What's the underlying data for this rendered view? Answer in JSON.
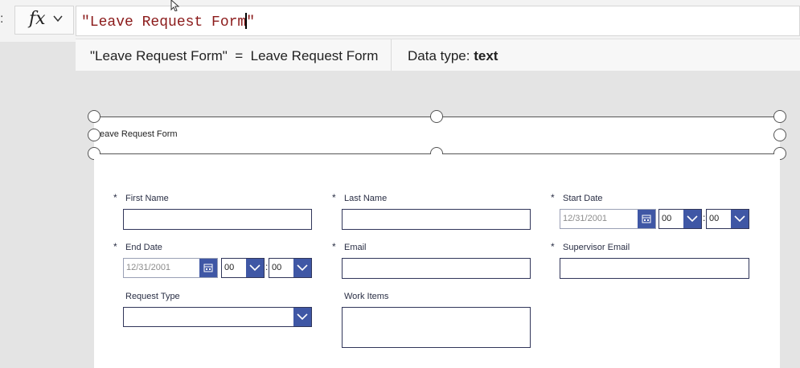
{
  "formula_bar": {
    "ellipsis": ":",
    "fx_label": "fx",
    "formula_before_caret": "\"Leave Request Form",
    "formula_after_caret": "\""
  },
  "result_bar": {
    "expression": "\"Leave Request Form\"  =  Leave Request Form",
    "datatype_label": "Data type: ",
    "datatype_value": "text"
  },
  "canvas": {
    "title_label": "eave Request Form"
  },
  "form": {
    "first_name": {
      "label": "First Name",
      "required": "*"
    },
    "last_name": {
      "label": "Last Name",
      "required": "*"
    },
    "start_date": {
      "label": "Start Date",
      "required": "*",
      "date": "12/31/2001",
      "hour": "00",
      "minute": "00"
    },
    "end_date": {
      "label": "End Date",
      "required": "*",
      "date": "12/31/2001",
      "hour": "00",
      "minute": "00"
    },
    "email": {
      "label": "Email",
      "required": "*"
    },
    "supervisor_email": {
      "label": "Supervisor Email",
      "required": "*"
    },
    "request_type": {
      "label": "Request Type"
    },
    "work_items": {
      "label": "Work Items"
    },
    "time_separator": ":"
  },
  "colors": {
    "accent": "#3f57a5",
    "formula_text": "#8b1a1a",
    "border": "#31365a"
  }
}
